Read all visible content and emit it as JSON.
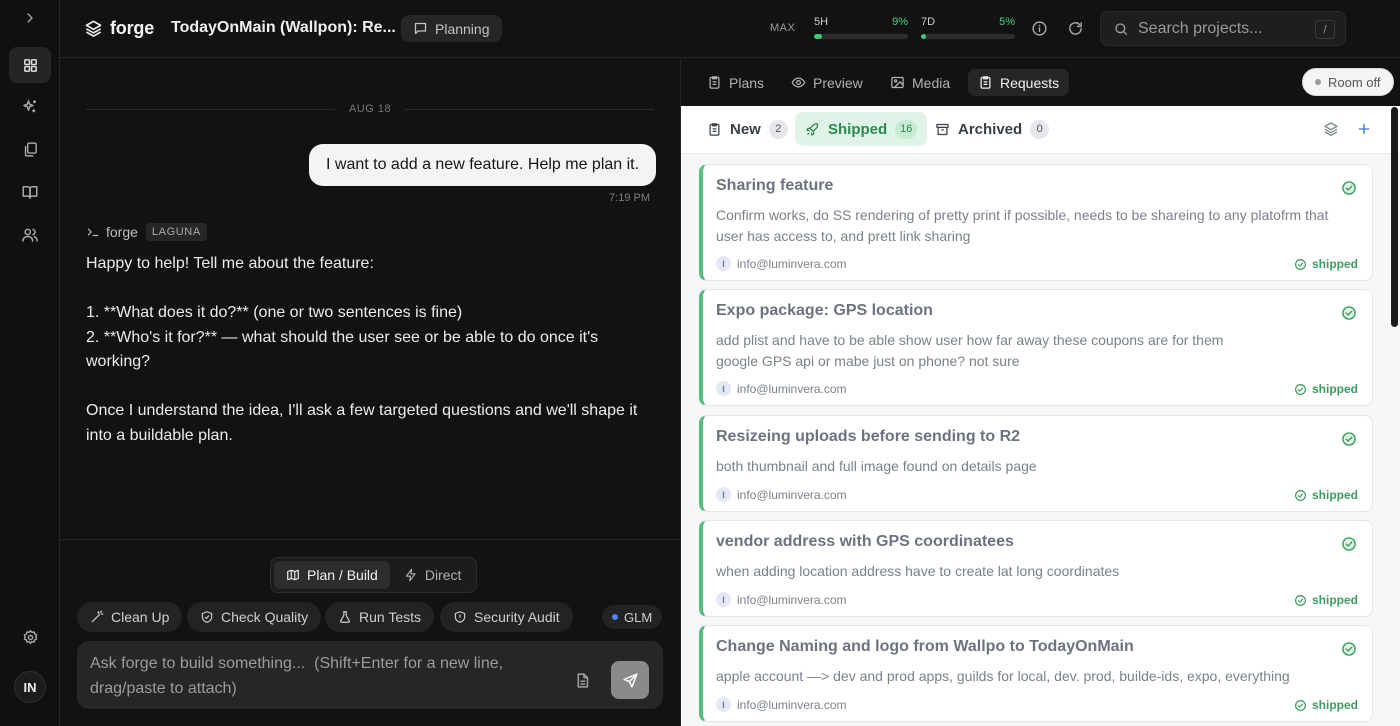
{
  "app": {
    "name": "forge",
    "project_title": "TodayOnMain (Wallpon): Re...",
    "mode": "Planning"
  },
  "usage": {
    "max_label": "MAX",
    "short": {
      "label": "5H",
      "percent_text": "9%",
      "fraction": 0.09
    },
    "week": {
      "label": "7D",
      "percent_text": "5%",
      "fraction": 0.05
    }
  },
  "search": {
    "placeholder": "Search projects...",
    "shortcut": "/"
  },
  "rail": {
    "icons": [
      "chevron-right-icon",
      "grid-icon",
      "sparkles-icon",
      "copy-icon",
      "book-icon",
      "users-icon",
      "gear-icon"
    ],
    "avatar_initials": "IN"
  },
  "chat": {
    "date_separator": "AUG 18",
    "user_message": "I want to add a new feature. Help me plan it.",
    "user_message_time": "7:19 PM",
    "agent_name": "forge",
    "agent_badge": "LAGUNA",
    "agent_lines": [
      "Happy to help! Tell me about the feature:",
      "",
      "1. **What does it do?** (one or two sentences is fine)",
      "2. **Who's it for?** — what should the user see or be able to do once it's working?",
      "",
      "Once I understand the idea, I'll ask a few targeted questions and we'll shape it into a buildable plan."
    ]
  },
  "composer": {
    "modes": [
      {
        "label": "Plan / Build",
        "active": true
      },
      {
        "label": "Direct",
        "active": false
      }
    ],
    "actions": [
      "Clean Up",
      "Check Quality",
      "Run Tests",
      "Security Audit"
    ],
    "model": "GLM",
    "placeholder": "Ask forge to build something...  (Shift+Enter for a new line, drag/paste to attach)"
  },
  "right_tabs": [
    {
      "label": "Plans",
      "active": false
    },
    {
      "label": "Preview",
      "active": false
    },
    {
      "label": "Media",
      "active": false
    },
    {
      "label": "Requests",
      "active": true
    }
  ],
  "room_status": "Room off",
  "filters": [
    {
      "label": "New",
      "count": "2",
      "active": false
    },
    {
      "label": "Shipped",
      "count": "16",
      "active": true
    },
    {
      "label": "Archived",
      "count": "0",
      "active": false
    }
  ],
  "requests": [
    {
      "title": "Sharing feature",
      "description": "Confirm works, do SS rendering of pretty print if possible, needs to be shareing to any platofrm that user has access to, and prett link sharing",
      "author_initial": "I",
      "author": "info@luminvera.com",
      "status": "shipped"
    },
    {
      "title": "Expo package: GPS location",
      "description": "add plist and have to be able show user how far away these coupons are for them\ngoogle GPS api or mabe just on phone? not sure",
      "author_initial": "I",
      "author": "info@luminvera.com",
      "status": "shipped"
    },
    {
      "title": "Resizeing uploads before sending to R2",
      "description": "both thumbnail and full image found on details page",
      "author_initial": "I",
      "author": "info@luminvera.com",
      "status": "shipped"
    },
    {
      "title": "vendor address with GPS coordinatees",
      "description": "when adding location address have to create lat long coordinates",
      "author_initial": "I",
      "author": "info@luminvera.com",
      "status": "shipped"
    },
    {
      "title": "Change Naming and logo from Wallpo to TodayOnMain",
      "description": "apple account —> dev and prod apps, guilds for local, dev. prod, builde-ids, expo, everything",
      "author_initial": "I",
      "author": "info@luminvera.com",
      "status": "shipped"
    }
  ],
  "colors": {
    "accent_green": "#41c979",
    "shipped_green": "#3d9a5f",
    "dark_bg": "#121212",
    "model_dot": "#4f86f7"
  }
}
